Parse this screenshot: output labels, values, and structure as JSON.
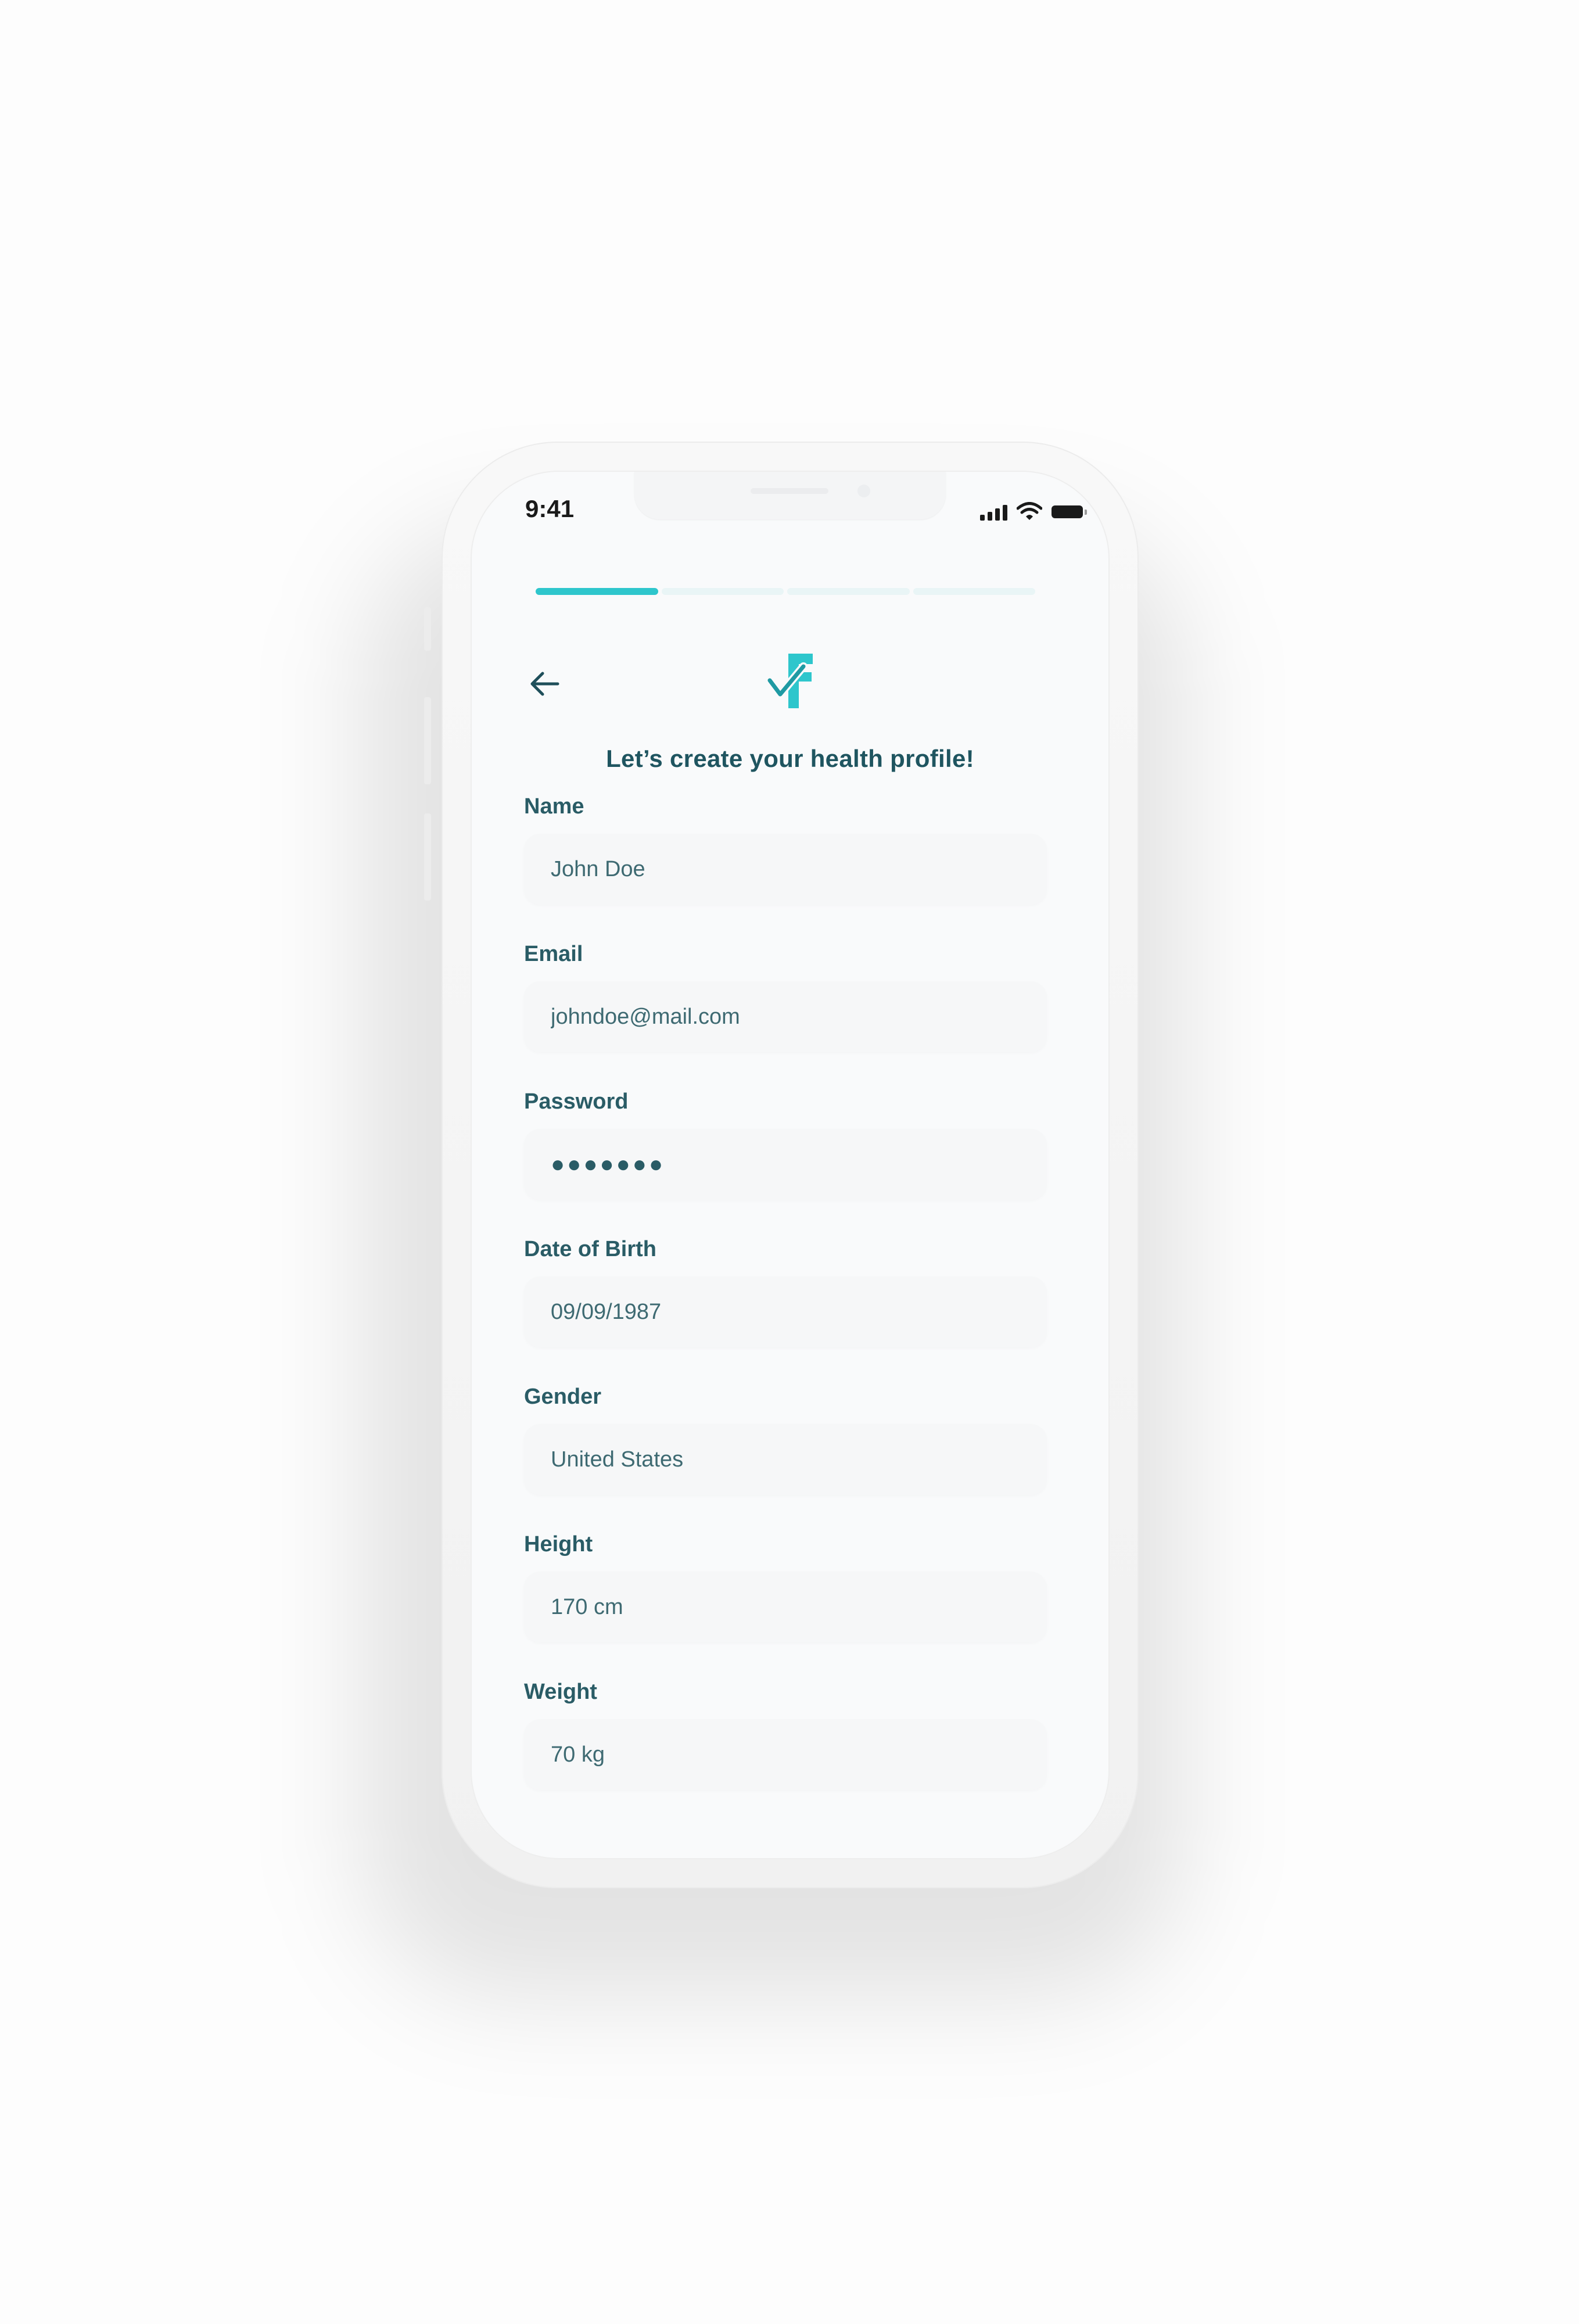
{
  "status_bar": {
    "time": "9:41",
    "icons": [
      "signal-icon",
      "wifi-icon",
      "battery-icon"
    ]
  },
  "progress": {
    "steps_total": 4,
    "current_step": 1,
    "accent_color": "#2ec6cc"
  },
  "header": {
    "back_icon": "arrow-left-icon",
    "logo_icon": "app-logo-icon",
    "title": "Let’s  create your health profile!"
  },
  "form": {
    "fields": [
      {
        "label": "Name",
        "value": "John Doe"
      },
      {
        "label": "Email",
        "value": "johndoe@mail.com"
      },
      {
        "label": "Password",
        "value": "●●●●●●●"
      },
      {
        "label": "Date of Birth",
        "value": "09/09/1987"
      },
      {
        "label": "Gender",
        "value": "United States"
      },
      {
        "label": "Height",
        "value": "170 cm"
      },
      {
        "label": "Weight",
        "value": "70 kg"
      }
    ]
  },
  "colors": {
    "text_primary": "#1f5560",
    "accent": "#2ec6cc",
    "screen_bg": "#f9fafb"
  }
}
